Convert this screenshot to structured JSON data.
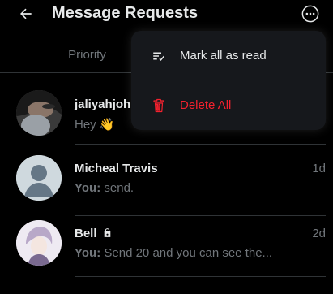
{
  "header": {
    "title": "Message Requests"
  },
  "tabs": [
    {
      "label": "Priority"
    }
  ],
  "conversations": [
    {
      "name": "jaliyahjoh",
      "time": "",
      "you_prefix": "",
      "preview": "Hey 👋"
    },
    {
      "name": "Micheal Travis",
      "time": "1d",
      "you_prefix": "You:",
      "preview": " send."
    },
    {
      "name": "Bell",
      "time": "2d",
      "you_prefix": "You:",
      "preview": " Send 20 and you can see the..."
    }
  ],
  "menu": {
    "items": [
      {
        "label": "Mark all as read",
        "icon": "mark-read-icon"
      },
      {
        "label": "Delete All",
        "icon": "trash-icon",
        "color": "#f4212e"
      }
    ]
  },
  "colors": {
    "background": "#000000",
    "text": "#e7e9ea",
    "muted": "#71767b",
    "danger": "#f4212e",
    "menu_bg": "#16181c"
  }
}
